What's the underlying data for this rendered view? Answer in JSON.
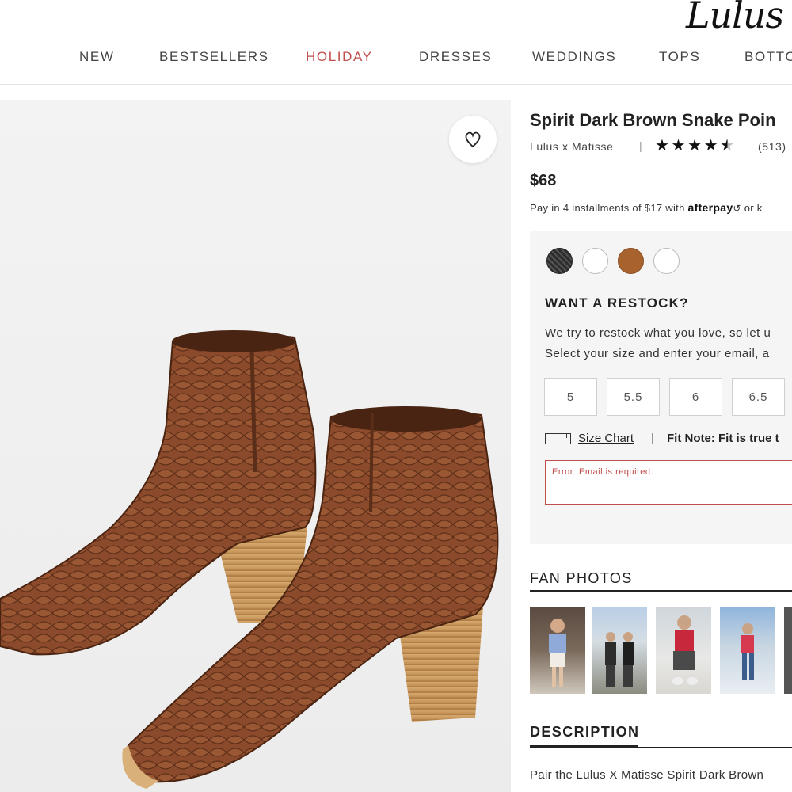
{
  "header": {
    "logo": "Lulus",
    "nav": [
      {
        "label": "NEW",
        "active": false
      },
      {
        "label": "BESTSELLERS",
        "active": false
      },
      {
        "label": "HOLIDAY",
        "active": true
      },
      {
        "label": "DRESSES",
        "active": false
      },
      {
        "label": "WEDDINGS",
        "active": false
      },
      {
        "label": "TOPS",
        "active": false
      },
      {
        "label": "BOTTO",
        "active": false
      }
    ]
  },
  "product": {
    "title": "Spirit Dark Brown Snake Poin",
    "brand": "Lulus x Matisse",
    "separator": "|",
    "rating": 4.5,
    "review_count": "(513)",
    "price": "$68",
    "installments_text": "Pay in 4 installments of $17 with",
    "afterpay_label": "afterpay",
    "installments_or": "or k",
    "wishlist_icon": "heart-icon"
  },
  "colors": {
    "accent": "#c0504d",
    "swatches": [
      "#3a3a3a",
      "#ffffff",
      "#a8622e",
      "#ffffff"
    ]
  },
  "restock": {
    "title": "WANT A RESTOCK?",
    "line1": "We try to restock what you love, so let u",
    "line2": "Select your size and enter your email, a",
    "sizes": [
      "5",
      "5.5",
      "6",
      "6.5"
    ],
    "size_chart_label": "Size Chart",
    "separator": "|",
    "fit_note": "Fit Note: Fit is true t",
    "email_error": "Error: Email is required."
  },
  "fan_photos": {
    "title": "FAN PHOTOS"
  },
  "description": {
    "title": "DESCRIPTION",
    "text": "Pair the Lulus X Matisse Spirit Dark Brown"
  }
}
